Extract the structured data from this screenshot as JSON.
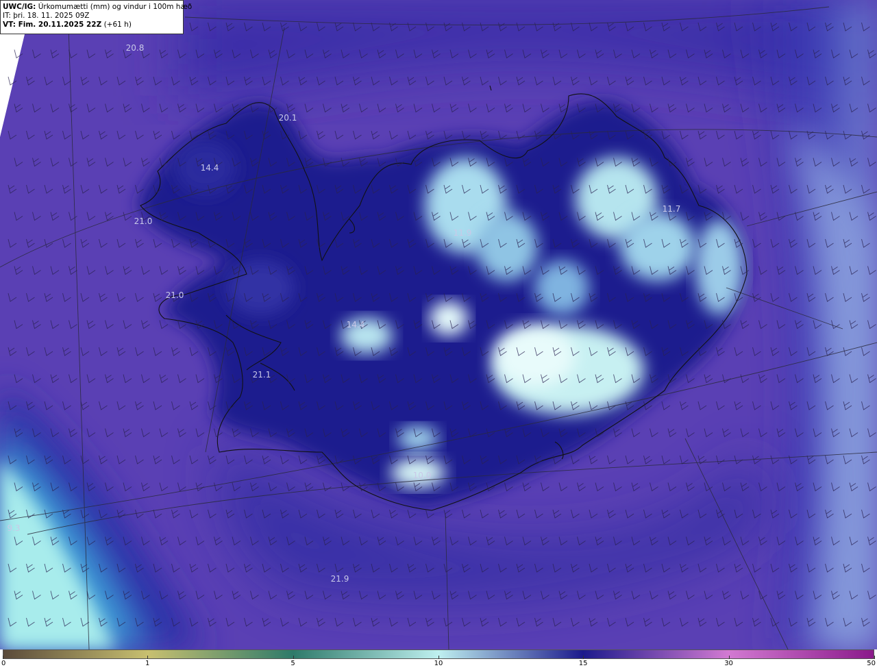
{
  "header": {
    "line1_bold": "UWC/IG:",
    "line1_rest": "Úrkomumætti (mm) og vindur i 100m hæð",
    "line2": "IT: þri. 18. 11. 2025 09Z",
    "line3_bold": "VT: Fim. 20.11.2025 22Z",
    "line3_rest": "(+61 h)"
  },
  "map_labels": [
    {
      "text": "20.8"
    },
    {
      "text": "20.1"
    },
    {
      "text": "14.4"
    },
    {
      "text": "21.0"
    },
    {
      "text": "21.0"
    },
    {
      "text": "11.9"
    },
    {
      "text": "11.7"
    },
    {
      "text": "14.4"
    },
    {
      "text": "21.1"
    },
    {
      "text": "10.0"
    },
    {
      "text": "9.3"
    },
    {
      "text": "21.9"
    }
  ],
  "colorbar": {
    "ticks": [
      "0",
      "1",
      "5",
      "10",
      "15",
      "30",
      "50"
    ],
    "colors": [
      "#5a4a3a",
      "#c8c070",
      "#2e7a6a",
      "#bff0f0",
      "#1c1a8c",
      "#d27ad2",
      "#8a1a8a"
    ]
  },
  "map_colors": {
    "ocean": "#5b3fb5",
    "deep": "#1f1a8f",
    "mid": "#3b3db8",
    "light": "#b8e8ee",
    "coast": "#111111",
    "barb": "#2a2250",
    "grid": "#2a2a3a"
  }
}
